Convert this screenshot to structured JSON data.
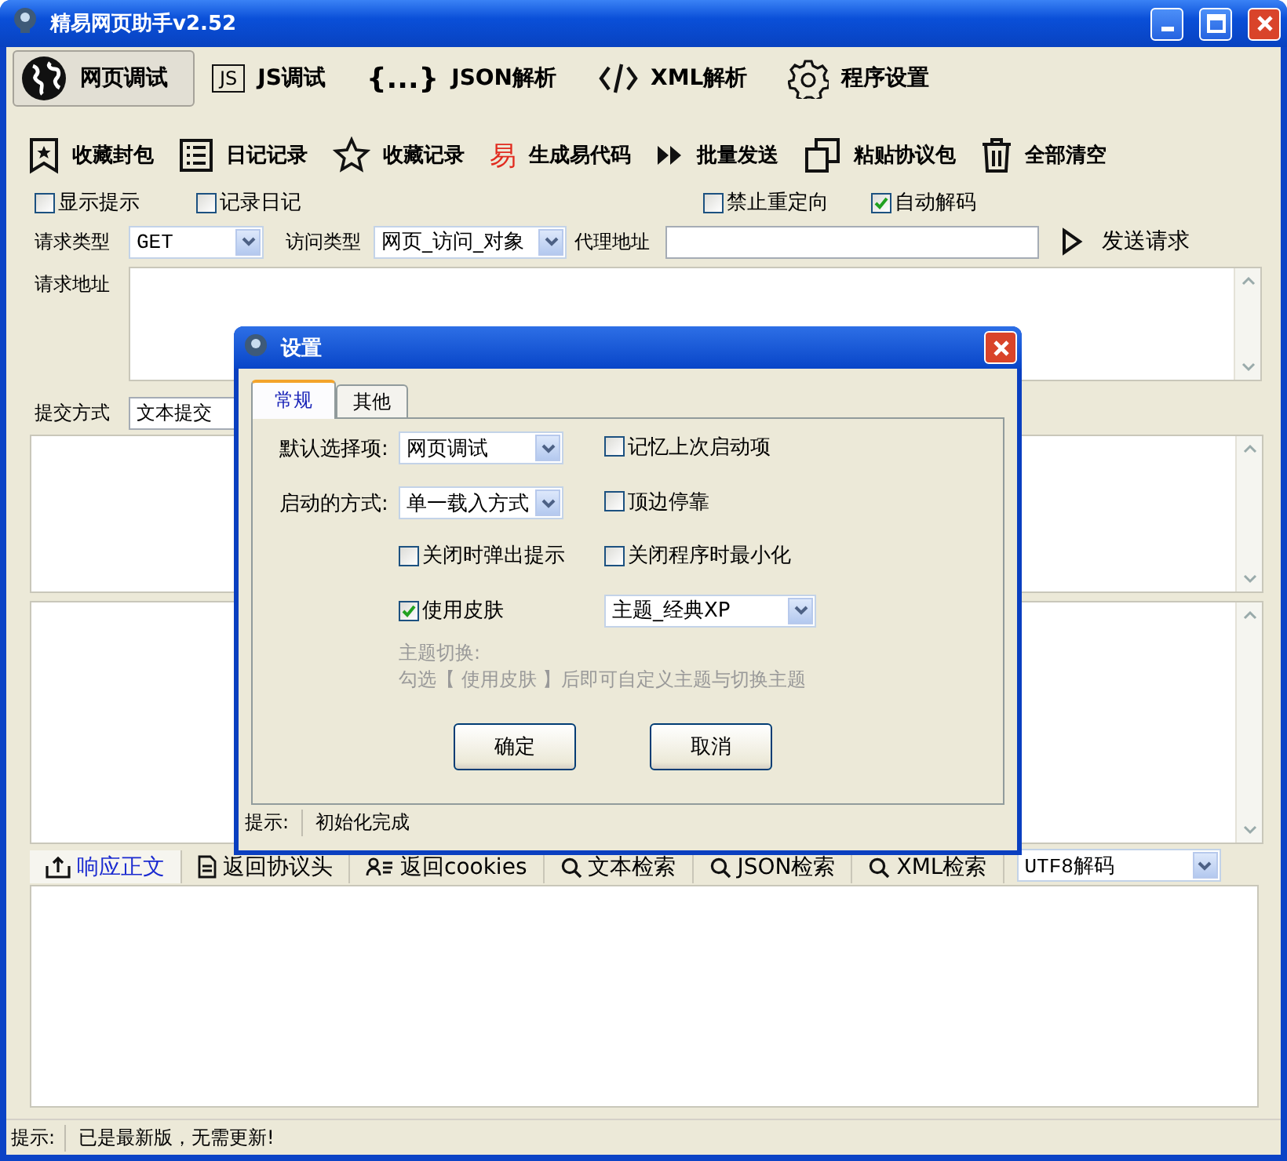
{
  "window": {
    "title": "精易网页助手v2.52"
  },
  "nav_tabs": [
    {
      "label": "网页调试",
      "selected": true,
      "kind": "globe"
    },
    {
      "label": "JS调试",
      "selected": false,
      "kind": "text",
      "icon_text": "JS"
    },
    {
      "label": "JSON解析",
      "selected": false,
      "kind": "text",
      "icon_text": "{...}"
    },
    {
      "label": "XML解析",
      "selected": false,
      "kind": "code"
    },
    {
      "label": "程序设置",
      "selected": false,
      "kind": "gear"
    }
  ],
  "toolbar": [
    {
      "label": "收藏封包",
      "kind": "bookmark"
    },
    {
      "label": "日记记录",
      "kind": "list"
    },
    {
      "label": "收藏记录",
      "kind": "star"
    },
    {
      "label": "生成易代码",
      "kind": "text",
      "icon_text": "易"
    },
    {
      "label": "批量发送",
      "kind": "play"
    },
    {
      "label": "粘贴协议包",
      "kind": "copy"
    },
    {
      "label": "全部清空",
      "kind": "trash"
    }
  ],
  "options": [
    {
      "label": "显示提示",
      "checked": false
    },
    {
      "label": "记录日记",
      "checked": false
    },
    {
      "label": "禁止重定向",
      "checked": false
    },
    {
      "label": "自动解码",
      "checked": true
    }
  ],
  "request": {
    "method_label": "请求类型",
    "method": "GET",
    "access_label": "访问类型",
    "access": "网页_访问_对象",
    "proxy_label": "代理地址",
    "send": "发送请求",
    "url_label": "请求地址",
    "submit_label": "提交方式",
    "submit": "文本提交"
  },
  "result_tabs": [
    {
      "label": "响应正文",
      "selected": true,
      "kind": "upload"
    },
    {
      "label": "返回协议头",
      "selected": false,
      "kind": "document"
    },
    {
      "label": "返回cookies",
      "selected": false,
      "kind": "contacts"
    },
    {
      "label": "文本检索",
      "selected": false,
      "kind": "search"
    },
    {
      "label": "JSON检索",
      "selected": false,
      "kind": "search"
    },
    {
      "label": "XML检索",
      "selected": false,
      "kind": "search"
    }
  ],
  "encoding": "UTF8解码",
  "status_bar": {
    "label": "提示:",
    "text": "已是最新版，无需更新!"
  },
  "dialog": {
    "title": "设置",
    "tabs": [
      {
        "label": "常规",
        "selected": true
      },
      {
        "label": "其他",
        "selected": false
      }
    ],
    "default_label": "默认选择项:",
    "default_value": "网页调试",
    "startup_label": "启动的方式:",
    "startup_value": "单一载入方式",
    "checks": [
      {
        "label": "记忆上次启动项",
        "checked": false
      },
      {
        "label": "顶边停靠",
        "checked": false
      },
      {
        "label": "关闭时弹出提示",
        "checked": false
      },
      {
        "label": "关闭程序时最小化",
        "checked": false
      },
      {
        "label": "使用皮肤",
        "checked": true
      }
    ],
    "theme": "主题_经典XP",
    "hint_title": "主题切换:",
    "hint_text": "勾选【 使用皮肤 】后即可自定义主题与切换主题",
    "buttons": [
      "确定",
      "取消"
    ],
    "status_bar": {
      "label": "提示:",
      "text": "初始化完成"
    }
  }
}
